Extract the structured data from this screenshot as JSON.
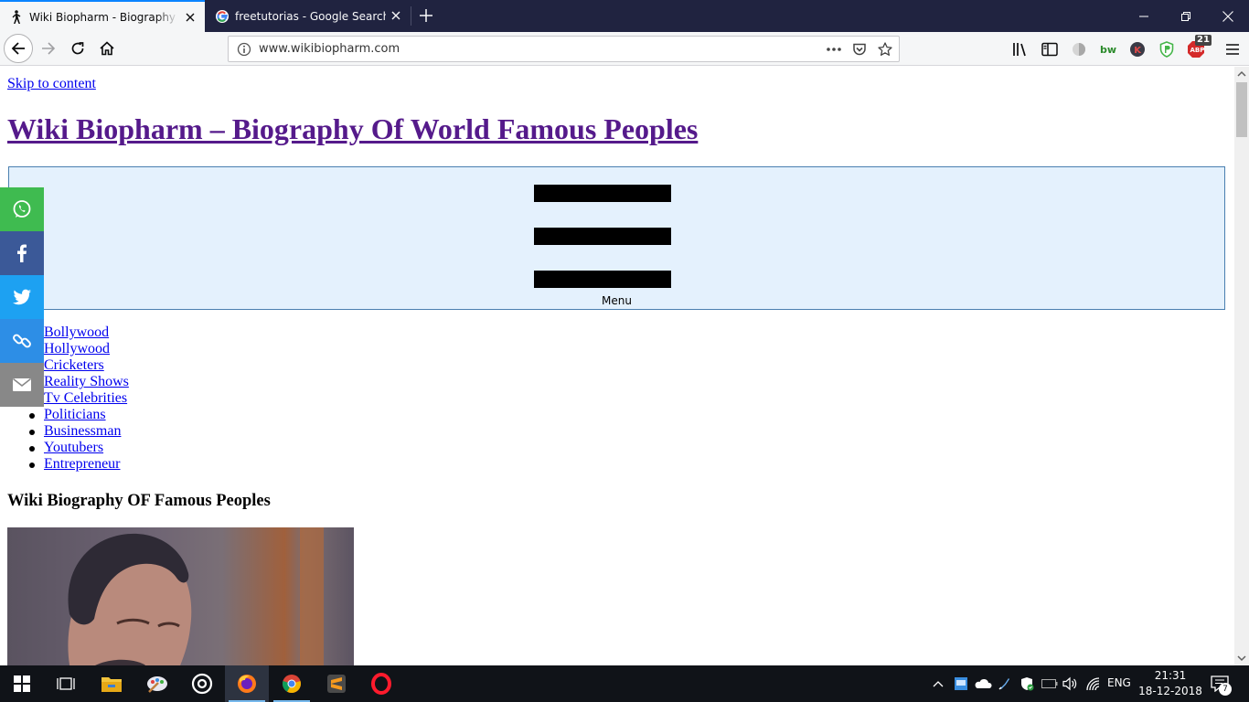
{
  "browser": {
    "tabs": [
      {
        "title": "Wiki Biopharm - Biography of t",
        "active": true
      },
      {
        "title": "freetutorias - Google Search",
        "active": false
      }
    ],
    "url": "www.wikibiopharm.com",
    "toolbar_badges": {
      "adblock_count": "21"
    }
  },
  "page": {
    "skip_link": "Skip to content",
    "site_title": "Wiki Biopharm – Biography Of World Famous Peoples",
    "menu_label": "Menu",
    "menu_items": [
      "Bollywood",
      "Hollywood",
      "Cricketers",
      "Reality Shows",
      "Tv Celebrities",
      "Politicians",
      "Businessman",
      "Youtubers",
      "Entrepreneur"
    ],
    "section_heading": "Wiki Biography OF Famous Peoples"
  },
  "share_bar": [
    {
      "name": "whatsapp",
      "color": "#3fbb50"
    },
    {
      "name": "facebook",
      "color": "#3b5998"
    },
    {
      "name": "twitter",
      "color": "#1da1f2"
    },
    {
      "name": "copy-link",
      "color": "#2d8ee6"
    },
    {
      "name": "email",
      "color": "#888888"
    }
  ],
  "taskbar": {
    "language": "ENG",
    "time": "21:31",
    "date": "18-12-2018",
    "notification_count": "7"
  }
}
